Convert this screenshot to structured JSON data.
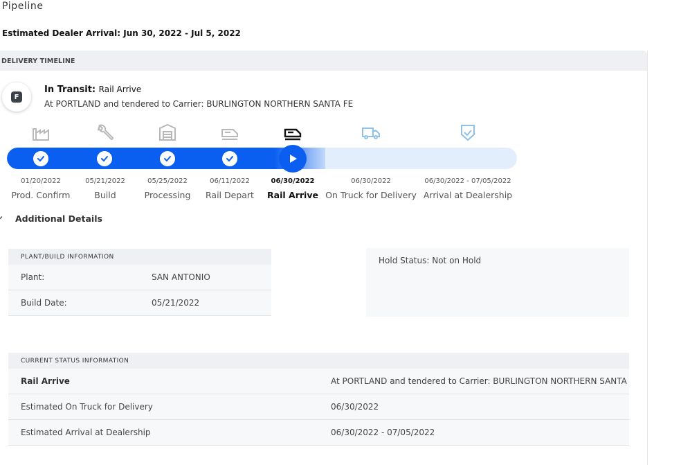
{
  "page_title": "Pipeline",
  "estimated_arrival": "Estimated Dealer Arrival: Jun 30, 2022 - Jul 5, 2022",
  "timeline": {
    "header": "DELIVERY TIMELINE",
    "badge_letter": "F",
    "status_prefix": "In Transit:",
    "status_stage": "Rail Arrive",
    "status_description": "At PORTLAND and tendered to Carrier: BURLINGTON NORTHERN SANTA FE",
    "progress_completed_steps": 4,
    "current_step": 5,
    "colors": {
      "accent": "#0a5ef0",
      "track": "#e3eefd",
      "future_icon": "#8ec0e8"
    },
    "stages": [
      {
        "date": "01/20/2022",
        "label": "Prod. Confirm",
        "icon": "factory-icon"
      },
      {
        "date": "05/21/2022",
        "label": "Build",
        "icon": "wrench-icon"
      },
      {
        "date": "05/25/2022",
        "label": "Processing",
        "icon": "processing-icon"
      },
      {
        "date": "06/11/2022",
        "label": "Rail Depart",
        "icon": "train-icon"
      },
      {
        "date": "06/30/2022",
        "label": "Rail Arrive",
        "icon": "train-icon"
      },
      {
        "date": "06/30/2022",
        "label": "On Truck for Delivery",
        "icon": "truck-icon"
      },
      {
        "date": "06/30/2022 - 07/05/2022",
        "label": "Arrival at Dealership",
        "icon": "shield-check-icon"
      }
    ]
  },
  "additional_details": {
    "toggle_label": "Additional Details",
    "plant_panel": {
      "header": "PLANT/BUILD INFORMATION",
      "rows": [
        {
          "key": "Plant:",
          "value": "SAN ANTONIO"
        },
        {
          "key": "Build Date:",
          "value": "05/21/2022"
        }
      ]
    },
    "hold_status": "Hold Status: Not on Hold",
    "status_panel": {
      "header": "CURRENT STATUS INFORMATION",
      "rows": [
        {
          "key": "Rail Arrive",
          "value": "At PORTLAND and tendered to Carrier: BURLINGTON NORTHERN SANTA FE"
        },
        {
          "key": "Estimated On Truck for Delivery",
          "value": "06/30/2022"
        },
        {
          "key": "Estimated Arrival at Dealership",
          "value": "06/30/2022 - 07/05/2022"
        }
      ]
    }
  }
}
